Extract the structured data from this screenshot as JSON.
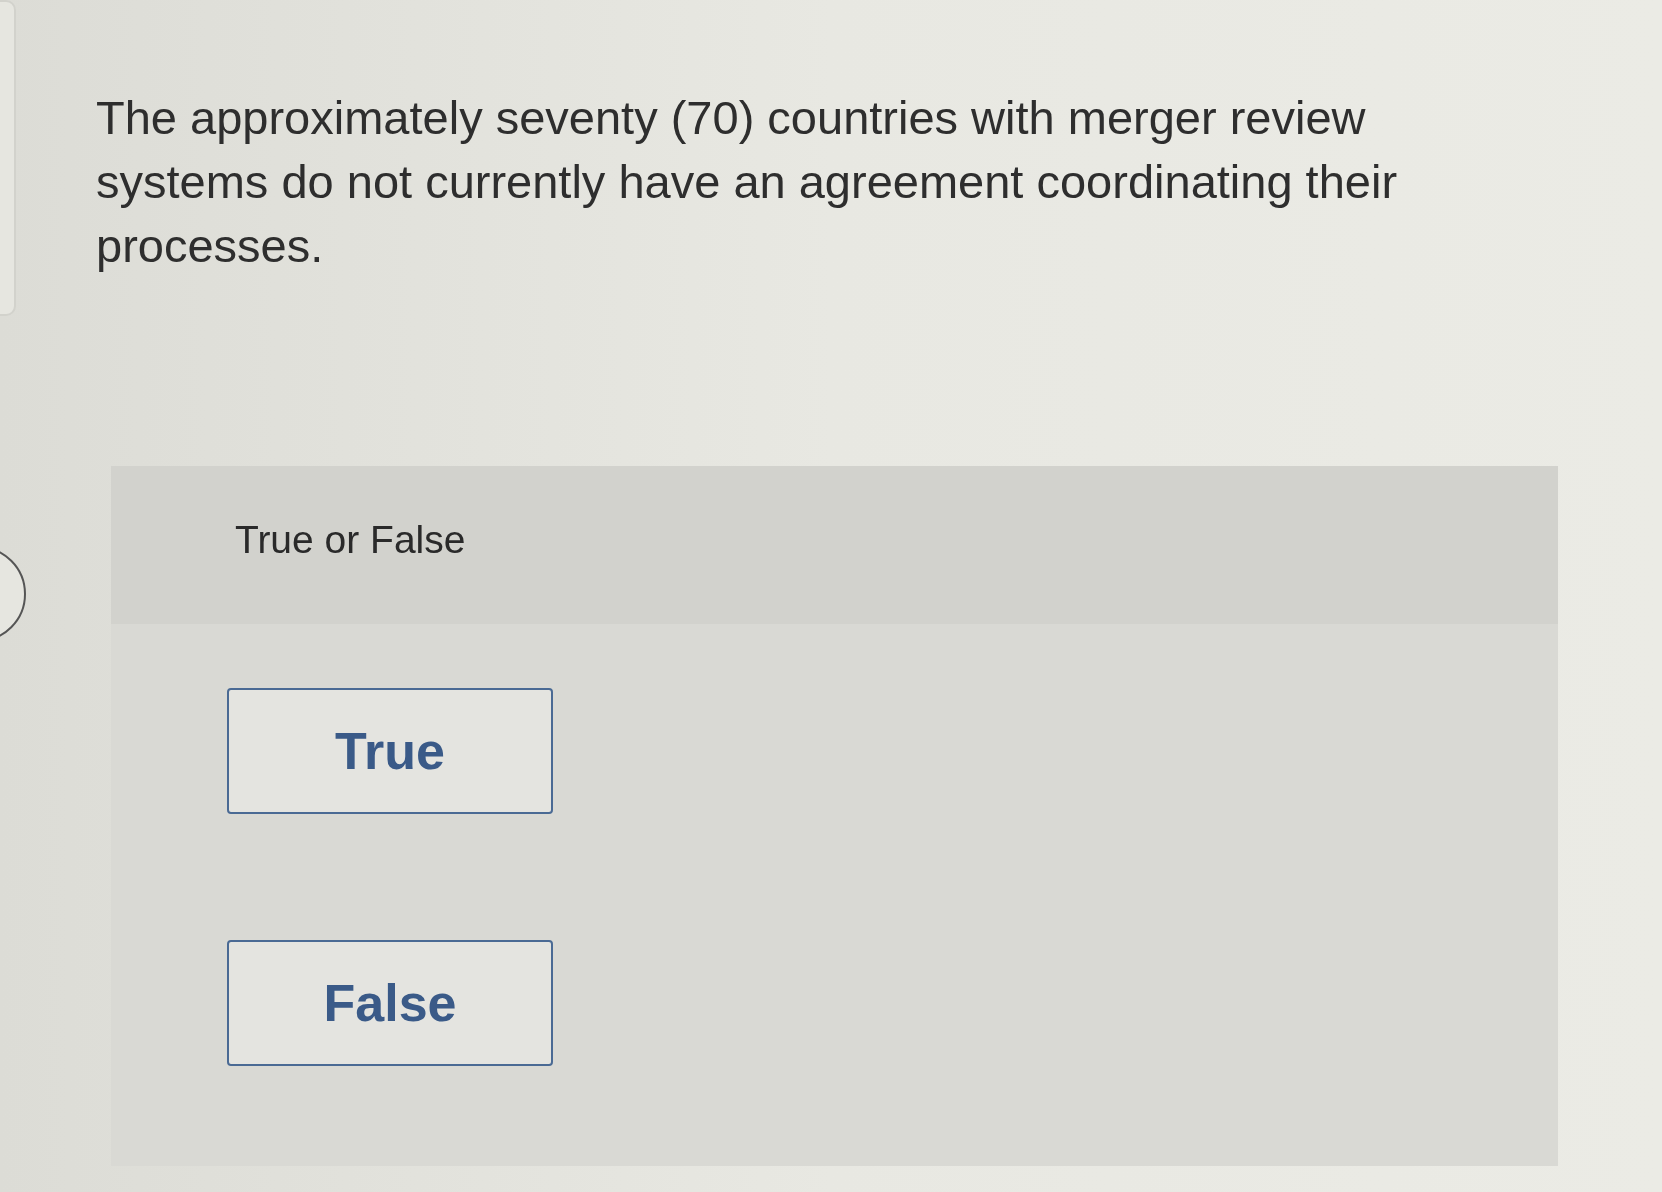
{
  "question": "The approximately seventy (70) countries with merger review systems do not currently have an agreement coordinating their processes.",
  "prompt": "True or False",
  "options": [
    {
      "label": "True",
      "selected": false
    },
    {
      "label": "False",
      "selected": false
    }
  ]
}
